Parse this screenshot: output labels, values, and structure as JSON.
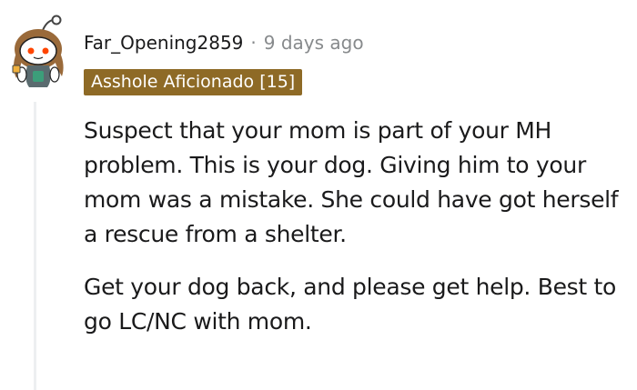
{
  "comment": {
    "author": "Far_Opening2859",
    "separator": "·",
    "timestamp": "9 days ago",
    "flair": "Asshole Aficionado [15]",
    "flair_color": "#8e6a26",
    "avatar_icon": "snoo-avatar-icon",
    "paragraphs": [
      "Suspect that your mom is part of your MH problem. This is your dog. Giving him to your mom was a mistake. She could have got herself a rescue from a shelter.",
      "Get your dog back, and please get help. Best to go LC/NC with mom."
    ]
  }
}
